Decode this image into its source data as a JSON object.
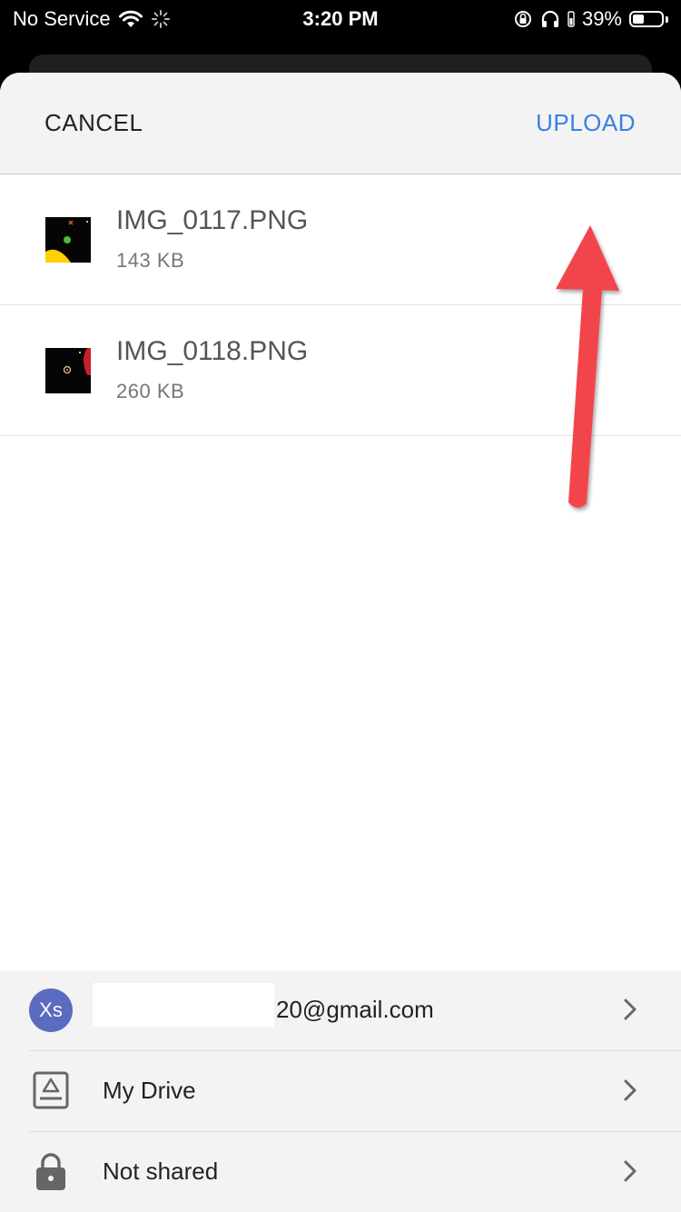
{
  "status_bar": {
    "carrier": "No Service",
    "time": "3:20 PM",
    "battery_percent": "39%",
    "battery_level": 0.39,
    "icons": [
      "wifi-icon",
      "activity-spinner-icon",
      "orientation-lock-icon",
      "headphones-icon",
      "battery-icon"
    ]
  },
  "header": {
    "cancel_label": "CANCEL",
    "upload_label": "UPLOAD",
    "upload_color": "#3a7ee8"
  },
  "files": [
    {
      "name": "IMG_0117.PNG",
      "size": "143 KB",
      "thumbnail": "game-screenshot-yellow-green"
    },
    {
      "name": "IMG_0118.PNG",
      "size": "260 KB",
      "thumbnail": "game-screenshot-red"
    }
  ],
  "annotation": {
    "arrow_color": "#f24a4a",
    "points_to": "upload-button"
  },
  "destination": {
    "account": {
      "avatar_initials": "Xs",
      "avatar_color": "#5b6bc0",
      "email_visible": "20@gmail.com"
    },
    "folder": {
      "label": "My Drive",
      "icon": "drive-folder-icon"
    },
    "sharing": {
      "label": "Not shared",
      "icon": "lock-icon"
    }
  }
}
